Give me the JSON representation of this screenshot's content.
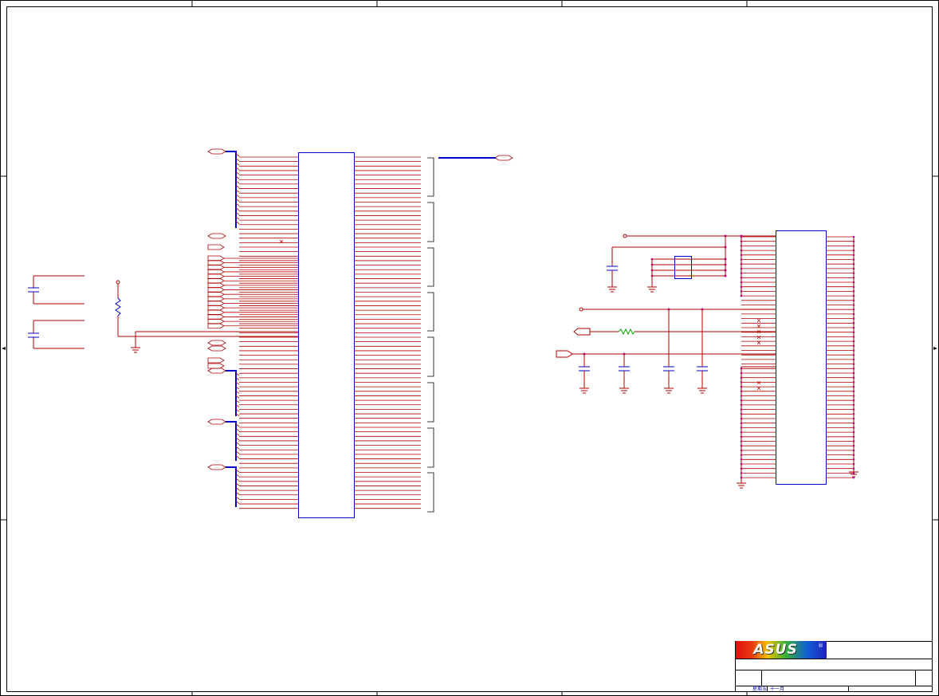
{
  "title_block": {
    "logo_text": "ASUS",
    "logo_mark": "®",
    "date_label": "星期五",
    "month_label": "十一月"
  },
  "colors": {
    "frame": "#000000",
    "wire": "#b00000",
    "bus": "#0000cc",
    "ic_outline": "#0000cc",
    "junction": "#cc00cc",
    "inductor": "#00aa00"
  },
  "icons": {
    "ground": "ground-icon",
    "capacitor": "capacitor-icon",
    "resistor": "resistor-icon",
    "no_connect": "no-connect-icon",
    "port": "port-icon"
  }
}
